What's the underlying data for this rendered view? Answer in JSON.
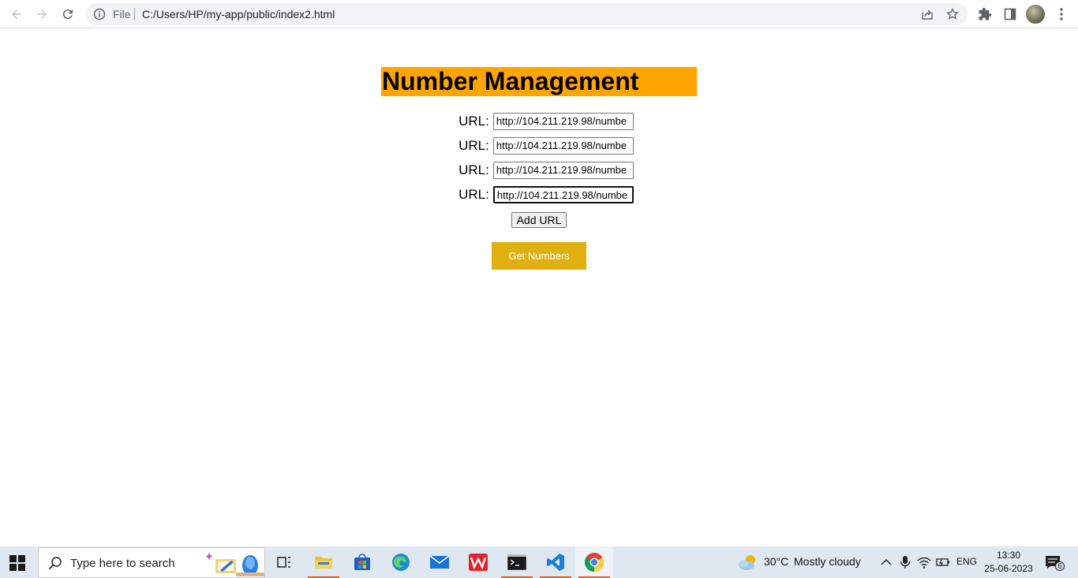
{
  "browser": {
    "omnibox_scheme": "File",
    "omnibox_url": "C:/Users/HP/my-app/public/index2.html"
  },
  "page": {
    "title": "Number Management",
    "url_label": "URL:",
    "urls": [
      {
        "value": "http://104.211.219.98/numbe"
      },
      {
        "value": "http://104.211.219.98/numbe"
      },
      {
        "value": "http://104.211.219.98/numbe"
      },
      {
        "value": "http://104.211.219.98/numbe"
      }
    ],
    "add_button_label": "Add URL",
    "get_button_label": "Get Numbers",
    "colors": {
      "title_bg": "#ffa500",
      "get_button_bg": "#e0b010"
    }
  },
  "taskbar": {
    "search_placeholder": "Type here to search",
    "weather_temp": "30°C",
    "weather_desc": "Mostly cloudy",
    "language": "ENG",
    "time": "13:30",
    "date": "25-06-2023",
    "notification_count": "6"
  }
}
